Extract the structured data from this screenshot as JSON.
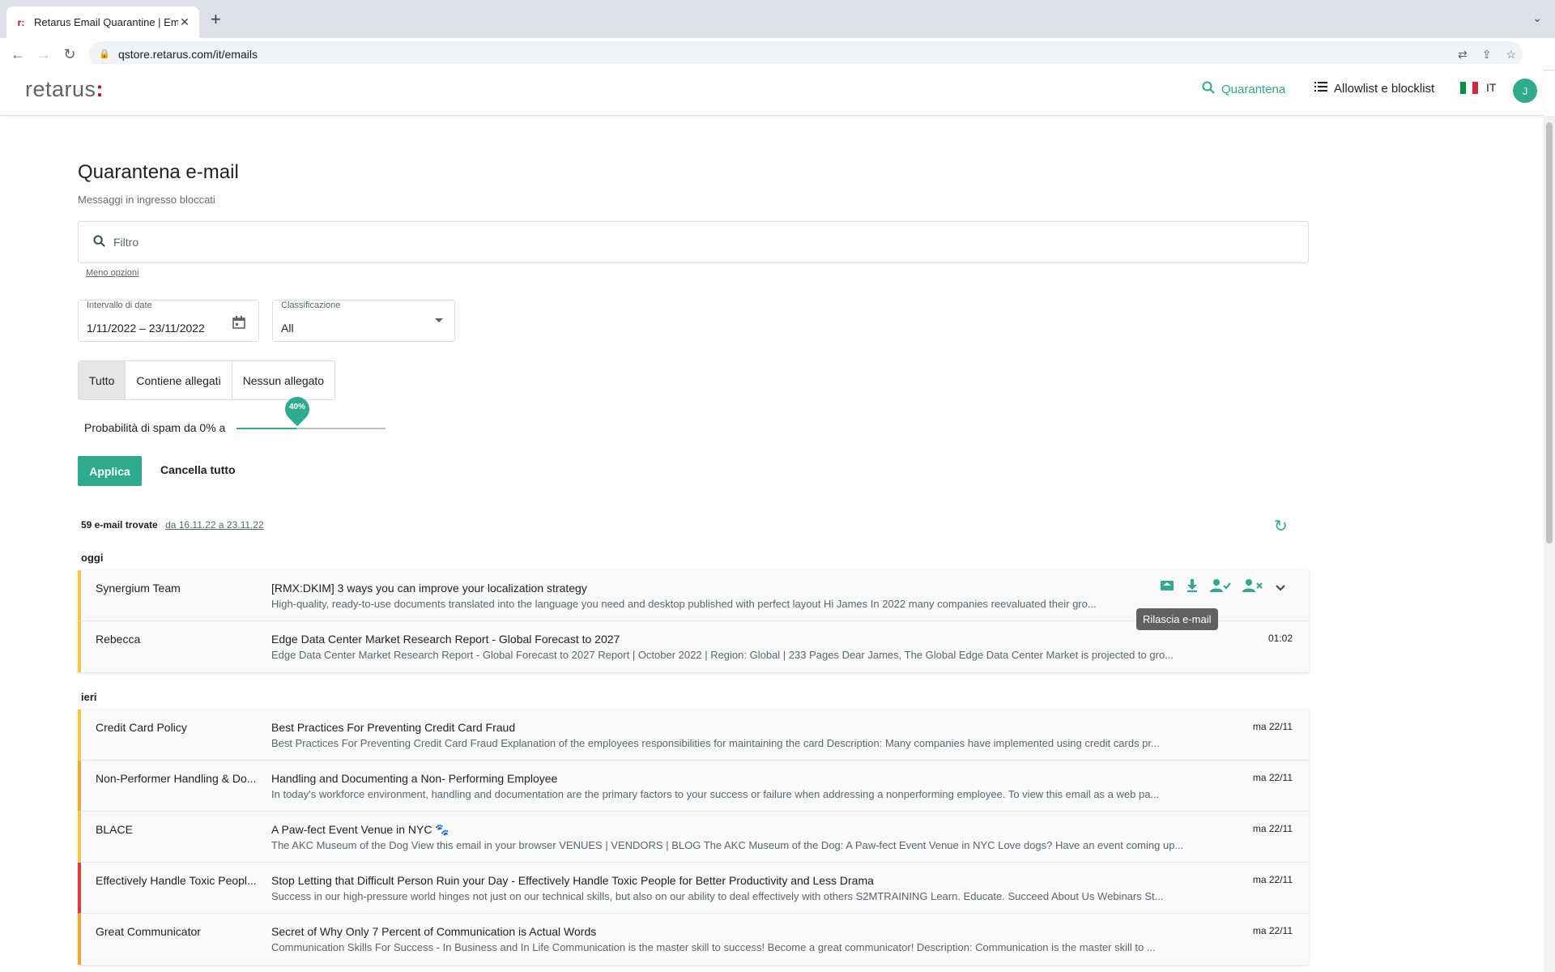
{
  "browser": {
    "tab_title": "Retarus Email Quarantine | Em",
    "url": "qstore.retarus.com/it/emails"
  },
  "header": {
    "logo": "retarus",
    "logo_mark": ":",
    "nav_quarantine": "Quarantena",
    "nav_lists": "Allowlist e blocklist",
    "lang": "IT",
    "avatar_initial": "J"
  },
  "page": {
    "title": "Quarantena e-mail",
    "subtitle": "Messaggi in ingresso bloccati",
    "filter_placeholder": "Filtro",
    "less_options": "Meno opzioni",
    "date_label": "Intervallo di date",
    "date_value": "1/11/2022 – 23/11/2022",
    "class_label": "Classificazione",
    "class_value": "All",
    "segments": [
      "Tutto",
      "Contiene allegati",
      "Nessun allegato"
    ],
    "spam_label": "Probabilità di spam da 0% a",
    "spam_value": "40%",
    "spam_level": 0.4,
    "apply_label": "Applica",
    "clear_label": "Cancella tutto",
    "found_count": "59 e-mail trovate",
    "found_range": "da 16.11.22 a 23.11.22"
  },
  "tooltip": "Rilascia e-mail",
  "groups": [
    {
      "label": "oggi",
      "emails": [
        {
          "sender": "Synergium Team",
          "subject": "[RMX:DKIM] 3 ways you can improve your localization strategy",
          "preview": "High-quality, ready-to-use documents translated into the language you need and desktop published with perfect layout Hi James In 2022 many companies reevaluated their gro...",
          "date": "",
          "color": "#f2c744"
        },
        {
          "sender": "Rebecca",
          "subject": "Edge Data Center Market Research Report - Global Forecast to 2027",
          "preview": "Edge Data Center Market Research Report - Global Forecast to 2027 Report | October 2022 | Region: Global | 233 Pages Dear James, The Global Edge Data Center Market is projected to gro...",
          "date": "01:02",
          "color": "#f2c744"
        }
      ]
    },
    {
      "label": "ieri",
      "emails": [
        {
          "sender": "Credit Card Policy",
          "subject": "Best Practices For Preventing Credit Card Fraud",
          "preview": "Best Practices For Preventing Credit Card Fraud Explanation of the employees responsibilities for maintaining the card  Description: Many companies have implemented using credit cards pr...",
          "date": "ma 22/11",
          "color": "#f2c744"
        },
        {
          "sender": "Non-Performer Handling & Do...",
          "subject": "Handling and Documenting a Non- Performing Employee",
          "preview": "In today's workforce environment, handling and documentation are the primary factors to your success or failure when addressing a nonperforming employee. To view this email as a web pa...",
          "date": "ma 22/11",
          "color": "#f0a830"
        },
        {
          "sender": "BLACE",
          "subject": "A Paw-fect Event Venue in NYC 🐾",
          "preview": "The AKC Museum of the Dog View this email in your browser VENUES | VENDORS | BLOG The AKC Museum of the Dog: A Paw-fect Event Venue in NYC Love dogs? Have an event coming up...",
          "date": "ma 22/11",
          "color": "#f2c744"
        },
        {
          "sender": "Effectively Handle Toxic Peopl...",
          "subject": "Stop Letting that Difficult Person Ruin your Day - Effectively Handle Toxic People for Better Productivity and Less Drama",
          "preview": "Success in our high-pressure world hinges not just on our technical skills, but also on our ability to deal effectively with others S2MTRAINING Learn. Educate. Succeed About Us Webinars St...",
          "date": "ma 22/11",
          "color": "#e53935"
        },
        {
          "sender": "Great Communicator",
          "subject": "Secret of Why Only 7 Percent of Communication is Actual Words",
          "preview": "Communication Skills For Success - In Business and In Life Communication is the master skill to success! Become a great communicator!  Description: Communication is the master skill to ...",
          "date": "ma 22/11",
          "color": "#f0a830"
        }
      ]
    }
  ]
}
